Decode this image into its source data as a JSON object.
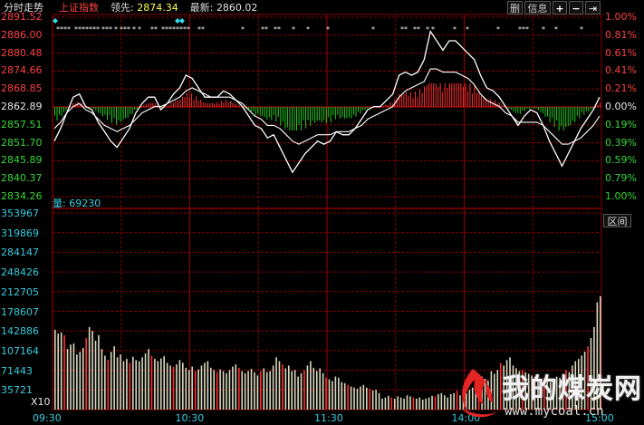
{
  "header": {
    "tab_label": "分时走势",
    "index_name": "上证指数",
    "lead_label": "领先:",
    "lead_value": "2874.34",
    "latest_label": "最新:",
    "latest_value": "2860.02"
  },
  "toolbar": {
    "delete_label": "删",
    "info_label": "信息",
    "plus_label": "+",
    "minus_label": "−",
    "exit_label": "⇥"
  },
  "volume_panel": {
    "volume_label": "量: 69230",
    "section_button": "区间",
    "scale_label": "X10"
  },
  "watermark": {
    "site_name": "我的煤炭网",
    "url": "www.mycoal.cn"
  },
  "colors": {
    "background": "#000000",
    "grid": "#8a0000",
    "up": "#ff3030",
    "down": "#22cc22",
    "price_line": "#ffffff",
    "volume_bar": "#d8d8c0",
    "axis_cyan": "#33ccdd"
  },
  "chart_data": [
    {
      "type": "line",
      "title": "",
      "y_labels": [
        "2891.52",
        "2886.00",
        "2880.48",
        "2874.66",
        "2868.85",
        "2862.89",
        "2857.51",
        "2851.70",
        "2845.89",
        "2840.37",
        "2834.26"
      ],
      "pct_labels": [
        "1.00%",
        "0.81%",
        "0.61%",
        "0.41%",
        "0.21%",
        "0.00%",
        "0.19%",
        "0.39%",
        "0.59%",
        "0.79%",
        "1.00%"
      ],
      "ylim": [
        2834.26,
        2891.52
      ],
      "base": 2862.89,
      "x_labels": [
        "09:30",
        "10:30",
        "11:30",
        "14:00",
        "15:00"
      ],
      "series": [
        {
          "values": [
            2852,
            2856,
            2861,
            2866,
            2867,
            2863,
            2862,
            2858,
            2855,
            2852,
            2850,
            2853,
            2856,
            2861,
            2864,
            2866,
            2866,
            2862,
            2864,
            2867,
            2869,
            2873,
            2872,
            2869,
            2866,
            2866,
            2866,
            2868,
            2867,
            2865,
            2863,
            2860,
            2857,
            2856,
            2853,
            2854,
            2850,
            2846,
            2842,
            2845,
            2848,
            2850,
            2852,
            2851,
            2852,
            2855,
            2854,
            2854,
            2856,
            2859,
            2862,
            2863,
            2863,
            2865,
            2867,
            2873,
            2874,
            2873,
            2874,
            2878,
            2887,
            2884,
            2881,
            2884,
            2884,
            2882,
            2880,
            2878,
            2873,
            2869,
            2868,
            2866,
            2863,
            2860,
            2857,
            2860,
            2862,
            2861,
            2857,
            2852,
            2848,
            2844,
            2848,
            2852,
            2856,
            2859,
            2862,
            2866
          ]
        },
        {
          "values": [
            2856,
            2858,
            2861,
            2863,
            2864,
            2862,
            2861,
            2859,
            2857,
            2856,
            2855,
            2856,
            2857,
            2859,
            2861,
            2862,
            2863,
            2863,
            2864,
            2865,
            2866,
            2868,
            2869,
            2868,
            2867,
            2866,
            2866,
            2866,
            2866,
            2865,
            2864,
            2862,
            2860,
            2859,
            2857,
            2857,
            2856,
            2854,
            2852,
            2851,
            2852,
            2853,
            2854,
            2854,
            2854,
            2855,
            2855,
            2855,
            2856,
            2857,
            2859,
            2860,
            2861,
            2862,
            2863,
            2866,
            2868,
            2869,
            2870,
            2871,
            2875,
            2875,
            2874,
            2874,
            2874,
            2873,
            2872,
            2870,
            2867,
            2865,
            2864,
            2863,
            2861,
            2860,
            2858,
            2858,
            2858,
            2858,
            2857,
            2855,
            2853,
            2851,
            2851,
            2852,
            2853,
            2855,
            2857,
            2860
          ]
        }
      ]
    },
    {
      "type": "bar",
      "title": "",
      "y_labels": [
        "353967",
        "319869",
        "284147",
        "248426",
        "212705",
        "178607",
        "142886",
        "107164",
        "71443",
        "35721"
      ],
      "ylim": [
        0,
        357195
      ],
      "values": [
        145,
        138,
        140,
        135,
        110,
        118,
        120,
        100,
        105,
        112,
        130,
        150,
        143,
        125,
        135,
        110,
        98,
        90,
        105,
        115,
        95,
        100,
        88,
        92,
        85,
        96,
        90,
        88,
        95,
        102,
        110,
        98,
        92,
        88,
        93,
        97,
        85,
        80,
        78,
        82,
        90,
        85,
        76,
        72,
        78,
        70,
        73,
        80,
        85,
        88,
        76,
        72,
        68,
        73,
        70,
        66,
        72,
        78,
        82,
        76,
        70,
        66,
        70,
        74,
        68,
        62,
        70,
        75,
        68,
        70,
        80,
        95,
        88,
        82,
        75,
        80,
        70,
        72,
        60,
        66,
        72,
        80,
        88,
        76,
        70,
        75,
        66,
        58,
        55,
        52,
        60,
        58,
        50,
        48,
        45,
        42,
        40,
        38,
        42,
        45,
        40,
        38,
        35,
        36,
        30,
        20,
        22,
        25,
        22,
        20,
        24,
        22,
        20,
        26,
        24,
        22,
        20,
        22,
        18,
        20,
        22,
        25,
        24,
        28,
        30,
        26,
        22,
        28,
        30,
        34,
        26,
        32,
        30,
        36,
        40,
        45,
        50,
        60,
        56,
        52,
        70,
        65,
        72,
        85,
        80,
        90,
        95,
        80,
        75,
        70,
        72,
        68,
        65,
        62,
        60,
        56,
        55,
        58,
        52,
        50,
        55,
        60,
        58,
        65,
        72,
        68,
        80,
        88,
        92,
        98,
        105,
        115,
        130,
        150,
        195,
        206
      ]
    }
  ]
}
